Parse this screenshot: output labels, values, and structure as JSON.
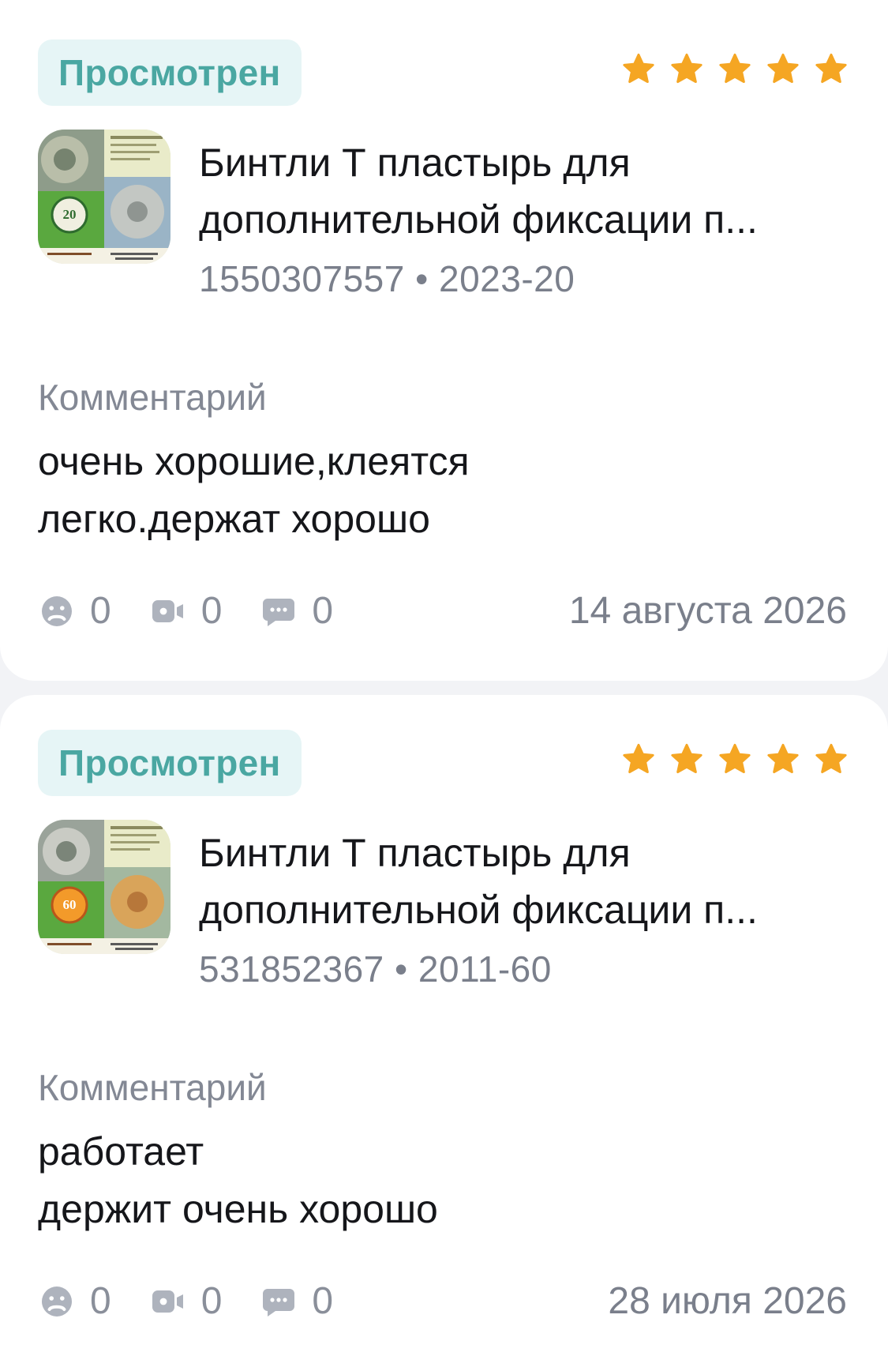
{
  "colors": {
    "badge_bg": "#e6f5f6",
    "badge_text": "#4aa7a2",
    "star": "#f5a623",
    "muted_text": "#7a7f8b",
    "primary_text": "#15161a"
  },
  "reviews": [
    {
      "status": "Просмотрен",
      "rating": 5,
      "thumbnail_number": "20",
      "product_title_line1": "Бинтли Т пластырь для",
      "product_title_line2": "дополнительной фиксации п...",
      "product_meta": "1550307557 • 2023-20",
      "comment_label": "Комментарий",
      "comment_line1": "очень хорошие,клеятся",
      "comment_line2": "легко.держат хорошо",
      "stats": {
        "dislikes": "0",
        "photos": "0",
        "comments": "0"
      },
      "date": "14 августа 2026"
    },
    {
      "status": "Просмотрен",
      "rating": 5,
      "thumbnail_number": "60",
      "product_title_line1": "Бинтли Т пластырь для",
      "product_title_line2": "дополнительной фиксации п...",
      "product_meta": "531852367 • 2011-60",
      "comment_label": "Комментарий",
      "comment_line1": "работает",
      "comment_line2": "держит очень хорошо",
      "stats": {
        "dislikes": "0",
        "photos": "0",
        "comments": "0"
      },
      "date": "28 июля 2026"
    }
  ]
}
